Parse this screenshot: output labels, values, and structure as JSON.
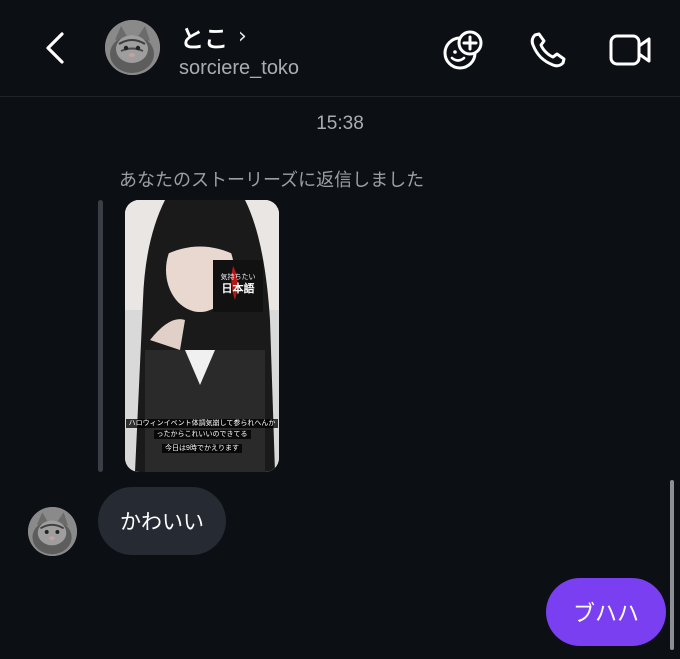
{
  "header": {
    "display_name": "とこ",
    "username": "sorciere_toko",
    "chevron": "›",
    "icons": [
      "back-icon",
      "add-reaction-icon",
      "phone-icon",
      "video-icon"
    ]
  },
  "thread": {
    "timestamp": "15:38",
    "story_reply_note": "あなたのストーリーズに返信しました",
    "story": {
      "sticker_line1": "気持ちたい",
      "sticker_line2": "日本語",
      "caption_line1": "ハロウィンイベント体調気崩して参られへんか",
      "caption_line2": "ったからこれいいのできてる",
      "caption_line3": "今日は9時でかえります"
    },
    "incoming_message": "かわいい",
    "outgoing_message": "ブハハ"
  },
  "colors": {
    "background": "#0c0f14",
    "incoming_bubble": "#262a32",
    "outgoing_bubble": "#7b3ff2",
    "secondary_text": "#a9adb4"
  }
}
